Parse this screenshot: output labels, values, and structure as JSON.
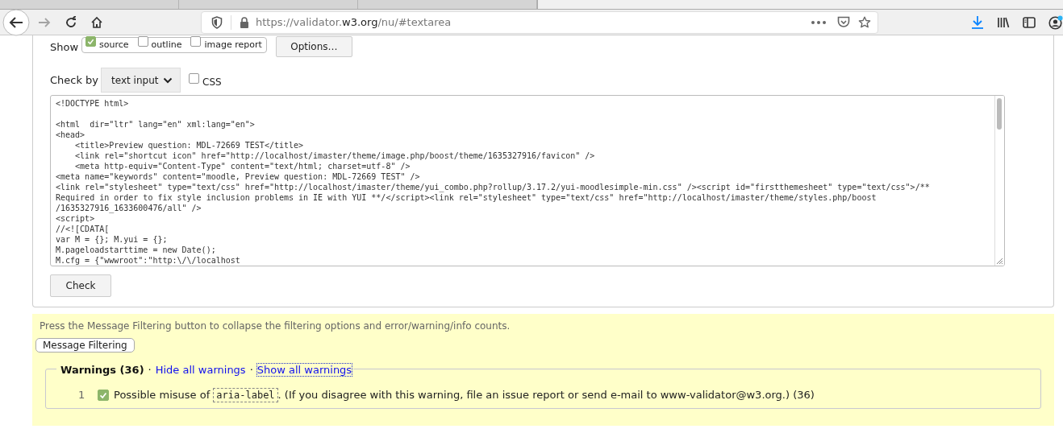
{
  "browser": {
    "tabs": [
      {
        "selected": false
      },
      {
        "selected": false
      },
      {
        "selected": false
      },
      {
        "selected": true
      }
    ],
    "back": {
      "disabled": false
    },
    "forward": {
      "disabled": true
    },
    "url": {
      "prefix": "https://validator.",
      "domain": "w3.org",
      "suffix": "/nu/#textarea"
    },
    "account_notification": true
  },
  "form": {
    "show_label": "Show",
    "show_options": [
      {
        "label": "source",
        "checked": true
      },
      {
        "label": "outline",
        "checked": false
      },
      {
        "label": "image report",
        "checked": false
      }
    ],
    "options_button": "Options…",
    "check_by_label": "Check by",
    "check_by_value": "text input",
    "css": {
      "label": "CSS",
      "checked": false
    },
    "source": "<!DOCTYPE html>\n\n<html  dir=\"ltr\" lang=\"en\" xml:lang=\"en\">\n<head>\n    <title>Preview question: MDL-72669 TEST</title>\n    <link rel=\"shortcut icon\" href=\"http://localhost/imaster/theme/image.php/boost/theme/1635327916/favicon\" />\n    <meta http-equiv=\"Content-Type\" content=\"text/html; charset=utf-8\" />\n<meta name=\"keywords\" content=\"moodle, Preview question: MDL-72669 TEST\" />\n<link rel=\"stylesheet\" type=\"text/css\" href=\"http://localhost/imaster/theme/yui_combo.php?rollup/3.17.2/yui-moodlesimple-min.css\" /><script id=\"firstthemesheet\" type=\"text/css\">/**\nRequired in order to fix style inclusion problems in IE with YUI **/</script><link rel=\"stylesheet\" type=\"text/css\" href=\"http://localhost/imaster/theme/styles.php/boost\n/1635327916_1633600476/all\" />\n<script>\n//<![CDATA[\nvar M = {}; M.yui = {};\nM.pageloadstarttime = new Date();\nM.cfg = {\"wwwroot\":\"http:\\/\\/localhost",
    "check_button": "Check"
  },
  "messages": {
    "filter_hint": "Press the Message Filtering button to collapse the filtering options and error/warning/info counts.",
    "filter_button": "Message Filtering",
    "warnings": {
      "title": "Warnings (36)",
      "links": [
        {
          "separator": "·",
          "label": "Hide all warnings",
          "focused": false
        },
        {
          "separator": "·",
          "label": "Show all warnings",
          "focused": true
        }
      ],
      "items": [
        {
          "number": "1",
          "checked": true,
          "message_before": "Possible misuse of ",
          "code": "aria-label",
          "message_after": ". (If you disagree with this warning, file an issue report or send e-mail to www-validator@w3.org.) (36)"
        }
      ]
    }
  }
}
